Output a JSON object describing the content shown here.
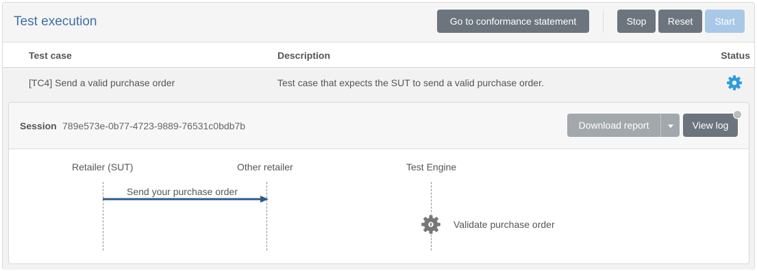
{
  "header": {
    "title": "Test execution",
    "buttons": {
      "conformance": "Go to conformance statement",
      "stop": "Stop",
      "reset": "Reset",
      "start": "Start"
    }
  },
  "table": {
    "columns": {
      "test_case": "Test case",
      "description": "Description",
      "status": "Status"
    },
    "rows": [
      {
        "test_case": "[TC4] Send a valid purchase order",
        "description": "Test case that expects the SUT to send a valid purchase order.",
        "status_icon": "gear-icon",
        "status_color": "#2f9be0"
      }
    ]
  },
  "session": {
    "label": "Session",
    "id": "789e573e-0b77-4723-9889-76531c0bdb7b",
    "buttons": {
      "download_report": "Download report",
      "view_log": "View log"
    },
    "status_dot_color": "#bdbdbd"
  },
  "diagram": {
    "actors": [
      "Retailer (SUT)",
      "Other retailer",
      "Test Engine"
    ],
    "message": {
      "label": "Send your purchase order",
      "from": "Retailer (SUT)",
      "to": "Other retailer",
      "color": "#2a5b86"
    },
    "step": {
      "label": "Validate purchase order",
      "actor": "Test Engine",
      "icon": "gear-icon"
    }
  },
  "colors": {
    "accent": "#3e6fa6",
    "button_dark": "#6c757d",
    "button_disabled": "#a9c8e8"
  }
}
